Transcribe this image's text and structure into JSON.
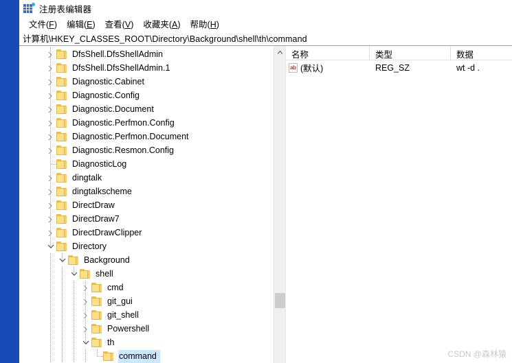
{
  "window": {
    "title": "注册表编辑器",
    "icon": "registry-icon"
  },
  "menubar": {
    "items": [
      {
        "label": "文件(F)",
        "pre": "文件(",
        "accel": "F",
        "post": ")"
      },
      {
        "label": "编辑(E)",
        "pre": "编辑(",
        "accel": "E",
        "post": ")"
      },
      {
        "label": "查看(V)",
        "pre": "查看(",
        "accel": "V",
        "post": ")"
      },
      {
        "label": "收藏夹(A)",
        "pre": "收藏夹(",
        "accel": "A",
        "post": ")"
      },
      {
        "label": "帮助(H)",
        "pre": "帮助(",
        "accel": "H",
        "post": ")"
      }
    ]
  },
  "address": {
    "path": "计算机\\HKEY_CLASSES_ROOT\\Directory\\Background\\shell\\th\\command"
  },
  "tree": {
    "items": [
      {
        "label": "DfsShell.DfsShellAdmin",
        "depth": 1,
        "state": "collapsed",
        "selected": false
      },
      {
        "label": "DfsShell.DfsShellAdmin.1",
        "depth": 1,
        "state": "collapsed",
        "selected": false
      },
      {
        "label": "Diagnostic.Cabinet",
        "depth": 1,
        "state": "collapsed",
        "selected": false
      },
      {
        "label": "Diagnostic.Config",
        "depth": 1,
        "state": "collapsed",
        "selected": false
      },
      {
        "label": "Diagnostic.Document",
        "depth": 1,
        "state": "collapsed",
        "selected": false
      },
      {
        "label": "Diagnostic.Perfmon.Config",
        "depth": 1,
        "state": "collapsed",
        "selected": false
      },
      {
        "label": "Diagnostic.Perfmon.Document",
        "depth": 1,
        "state": "collapsed",
        "selected": false
      },
      {
        "label": "Diagnostic.Resmon.Config",
        "depth": 1,
        "state": "collapsed",
        "selected": false
      },
      {
        "label": "DiagnosticLog",
        "depth": 1,
        "state": "leaf",
        "selected": false
      },
      {
        "label": "dingtalk",
        "depth": 1,
        "state": "collapsed",
        "selected": false
      },
      {
        "label": "dingtalkscheme",
        "depth": 1,
        "state": "collapsed",
        "selected": false
      },
      {
        "label": "DirectDraw",
        "depth": 1,
        "state": "collapsed",
        "selected": false
      },
      {
        "label": "DirectDraw7",
        "depth": 1,
        "state": "collapsed",
        "selected": false
      },
      {
        "label": "DirectDrawClipper",
        "depth": 1,
        "state": "collapsed",
        "selected": false
      },
      {
        "label": "Directory",
        "depth": 1,
        "state": "expanded",
        "selected": false
      },
      {
        "label": "Background",
        "depth": 2,
        "state": "expanded",
        "selected": false
      },
      {
        "label": "shell",
        "depth": 3,
        "state": "expanded",
        "selected": false
      },
      {
        "label": "cmd",
        "depth": 4,
        "state": "collapsed",
        "selected": false
      },
      {
        "label": "git_gui",
        "depth": 4,
        "state": "collapsed",
        "selected": false
      },
      {
        "label": "git_shell",
        "depth": 4,
        "state": "collapsed",
        "selected": false
      },
      {
        "label": "Powershell",
        "depth": 4,
        "state": "collapsed",
        "selected": false
      },
      {
        "label": "th",
        "depth": 4,
        "state": "expanded",
        "selected": false
      },
      {
        "label": "command",
        "depth": 5,
        "state": "leaf",
        "selected": true
      }
    ]
  },
  "values": {
    "columns": [
      "名称",
      "类型",
      "数据"
    ],
    "rows": [
      {
        "name": "(默认)",
        "type": "REG_SZ",
        "data": "wt -d .",
        "icon": "string-value-icon"
      }
    ]
  },
  "watermark": {
    "text": "CSDN @森林猿"
  },
  "colors": {
    "desktop": "#1a4ab8",
    "selection": "#cce8ff",
    "folder": "#fcdf8a",
    "folder_border": "#e2b73f"
  }
}
